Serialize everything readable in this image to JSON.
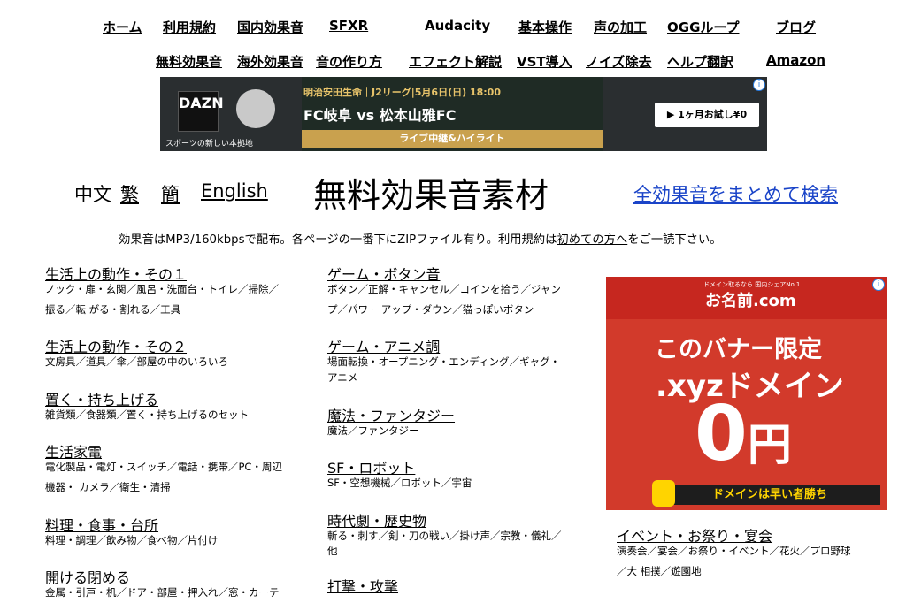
{
  "nav_row1": [
    "ホーム",
    "利用規約",
    "国内効果音",
    "SFXR",
    "Audacity",
    "基本操作",
    "声の加工",
    "OGGループ",
    "ブログ"
  ],
  "nav_row2": [
    "無料効果音",
    "海外効果音",
    "音の作り方",
    "エフェクト解説",
    "VST導入",
    "ノイズ除去",
    "ヘルプ翻訳",
    "Amazon"
  ],
  "ad1": {
    "logo": "DAZN",
    "tagline": "スポーツの新しい本拠地",
    "info": "i",
    "match_info": "明治安田生命｜J2リーグ|5月6日(日) 18:00",
    "match": "FC岐阜 vs 松本山雅FC",
    "bar": "ライブ中継&ハイライト",
    "button": "▶  1ヶ月お試し¥0"
  },
  "langs": {
    "chinese": "中文",
    "trad": "繁",
    "simp": "簡",
    "english": "English"
  },
  "title": "無料効果音素材",
  "search_link": "全効果音をまとめて検索",
  "notice": {
    "pre": "効果音はMP3/160kbpsで配布。各ページの一番下にZIPファイル有り。利用規約は",
    "link": "初めての方へ",
    "post": "をご一読下さい。"
  },
  "col1": [
    {
      "title": "生活上の動作・その１",
      "sub": [
        "ノック・扉・玄関／風呂・洗面台・トイレ／掃除／",
        "振る／転 がる・割れる／工具"
      ]
    },
    {
      "title": "生活上の動作・その２",
      "sub": [
        "文房具／道具／傘／部屋の中のいろいろ"
      ]
    },
    {
      "title": "置く・持ち上げる",
      "sub": [
        "雑貨類／食器類／置く・持ち上げるのセット"
      ]
    },
    {
      "title": "生活家電",
      "sub": [
        "電化製品・電灯・スイッチ／電話・携帯／PC・周辺",
        "機器・ カメラ／衛生・清掃"
      ]
    },
    {
      "title": "料理・食事・台所",
      "sub": [
        "料理・調理／飲み物／食べ物／片付け"
      ]
    },
    {
      "title": "開ける閉める",
      "sub": [
        "金属・引戸・机／ドア・部屋・押入れ／窓・カーテ"
      ]
    }
  ],
  "col2": [
    {
      "title": "ゲーム・ボタン音",
      "sub": [
        "ボタン／正解・キャンセル／コインを拾う／ジャン",
        "プ／パワ ーアップ・ダウン／猫っぽいボタン"
      ]
    },
    {
      "title": "ゲーム・アニメ調",
      "sub": [
        "場面転換・オープニング・エンディング／ギャグ・",
        "アニメ"
      ]
    },
    {
      "title": "魔法・ファンタジー",
      "sub": [
        "魔法／ファンタジー"
      ]
    },
    {
      "title": "SF・ロボット",
      "sub": [
        "SF・空想機械／ロボット／宇宙"
      ]
    },
    {
      "title": "時代劇・歴史物",
      "sub": [
        "斬る・刺す／剣・刀の戦い／掛け声／宗教・儀礼／",
        "他"
      ]
    },
    {
      "title": "打撃・攻撃",
      "sub": []
    }
  ],
  "col3": [
    {
      "title": "イベント・お祭り・宴会",
      "sub": [
        "演奏会／宴会／お祭り・イベント／花火／プロ野球",
        "／大 相撲／遊園地"
      ]
    }
  ],
  "ad2": {
    "small": "ドメイン取るなら 国内シェアNo.1",
    "brand": "お名前.com",
    "line1": "このバナー限定",
    "line2": ".xyzドメイン",
    "big": "0",
    "yen": "円",
    "footer": "ドメインは早い者勝ち",
    "info": "i"
  }
}
